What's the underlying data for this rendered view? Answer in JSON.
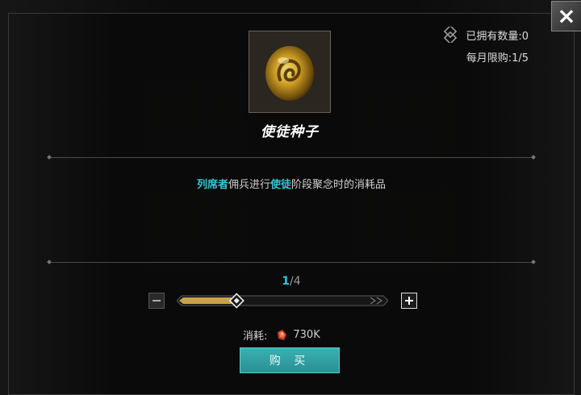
{
  "item": {
    "name": "使徒种子",
    "icon": "amber-seed-icon"
  },
  "stats": {
    "owned_label": "已拥有数量:0",
    "monthly_limit": "每月限购:1/5"
  },
  "description": {
    "part1": "列席者",
    "part2": "佣兵进行",
    "part3": "使徒",
    "part4": "阶段聚念时的消耗品"
  },
  "quantity": {
    "current": "1",
    "separator": "/",
    "max": "4",
    "fill_fraction": 0.25
  },
  "cost": {
    "label": "消耗:",
    "currency_icon": "red-gem-icon",
    "amount": "730K"
  },
  "buttons": {
    "buy": "购 买",
    "close": "×"
  },
  "colors": {
    "accent": "#35c6d4",
    "buy_button": "#2f9fa2",
    "slider_fill": "#c8a24a"
  }
}
